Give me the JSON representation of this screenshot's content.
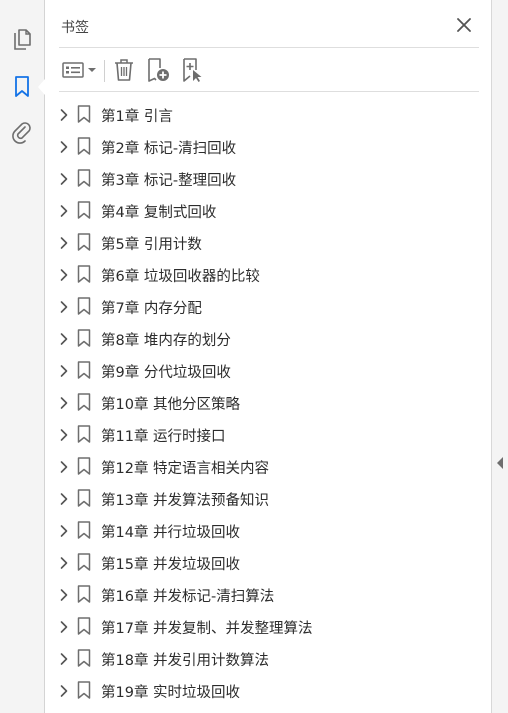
{
  "panel": {
    "title": "书签"
  },
  "bookmarks": [
    {
      "label": "第1章 引言"
    },
    {
      "label": "第2章 标记-清扫回收"
    },
    {
      "label": "第3章 标记-整理回收"
    },
    {
      "label": "第4章 复制式回收"
    },
    {
      "label": "第5章 引用计数"
    },
    {
      "label": "第6章 垃圾回收器的比较"
    },
    {
      "label": "第7章 内存分配"
    },
    {
      "label": "第8章 堆内存的划分"
    },
    {
      "label": "第9章 分代垃圾回收"
    },
    {
      "label": "第10章 其他分区策略"
    },
    {
      "label": "第11章 运行时接口"
    },
    {
      "label": "第12章 特定语言相关内容"
    },
    {
      "label": "第13章 并发算法预备知识"
    },
    {
      "label": "第14章 并行垃圾回收"
    },
    {
      "label": "第15章 并发垃圾回收"
    },
    {
      "label": "第16章 并发标记-清扫算法"
    },
    {
      "label": "第17章 并发复制、并发整理算法"
    },
    {
      "label": "第18章 并发引用计数算法"
    },
    {
      "label": "第19章 实时垃圾回收"
    }
  ],
  "icons": {
    "rail": [
      "pages-icon",
      "bookmark-icon",
      "attachment-icon"
    ],
    "toolbar": [
      "options-menu-icon",
      "delete-icon",
      "new-bookmark-icon",
      "bookmark-from-selection-icon"
    ]
  },
  "colors": {
    "accent": "#1473e6",
    "icon_gray": "#6e6e6e",
    "text": "#2c2c2c"
  }
}
